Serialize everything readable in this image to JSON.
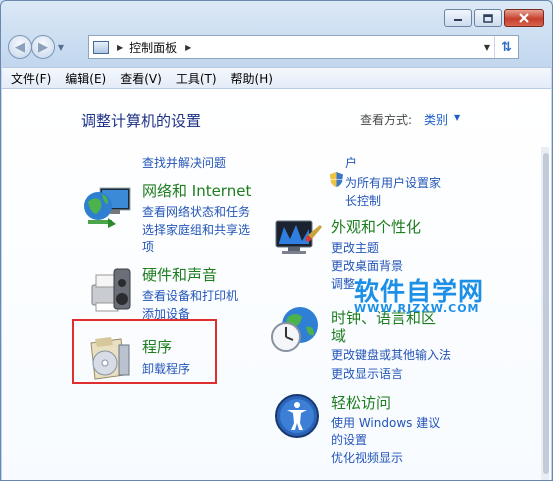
{
  "window": {
    "minimize_icon": "minimize-icon",
    "maximize_icon": "maximize-icon",
    "close_icon": "close-icon"
  },
  "nav": {
    "back_icon": "back-arrow-icon",
    "forward_icon": "forward-arrow-icon",
    "breadcrumb": "控制面板",
    "refresh_icon": "refresh-icon"
  },
  "menu": [
    "文件(F)",
    "编辑(E)",
    "查看(V)",
    "工具(T)",
    "帮助(H)"
  ],
  "content": {
    "heading": "调整计算机的设置",
    "view_by_label": "查看方式:",
    "view_by_value": "类别"
  },
  "left_categories": {
    "system": {
      "link1": "查找并解决问题"
    },
    "network": {
      "title": "网络和 Internet",
      "link1": "查看网络状态和任务",
      "link2a": "选择家庭组和共享选",
      "link2b": "项"
    },
    "hardware": {
      "title": "硬件和声音",
      "link1": "查看设备和打印机",
      "link2": "添加设备"
    },
    "programs": {
      "title": "程序",
      "link1": "卸载程序"
    }
  },
  "right_categories": {
    "accounts": {
      "link1": "户",
      "link2a": "为所有用户设置家",
      "link2b": "长控制"
    },
    "appearance": {
      "title": "外观和个性化",
      "link1": "更改主题",
      "link2": "更改桌面背景",
      "link3": "调整"
    },
    "clock": {
      "title_a": "时钟、语言和区",
      "title_b": "域",
      "link1": "更改键盘或其他输入法",
      "link2": "更改显示语言"
    },
    "ease": {
      "title": "轻松访问",
      "link1a": "使用 Windows 建议",
      "link1b": "的设置",
      "link2": "优化视频显示"
    }
  },
  "watermark": {
    "text": "软件自学网",
    "sub": "WWW.RJZXW.COM"
  }
}
